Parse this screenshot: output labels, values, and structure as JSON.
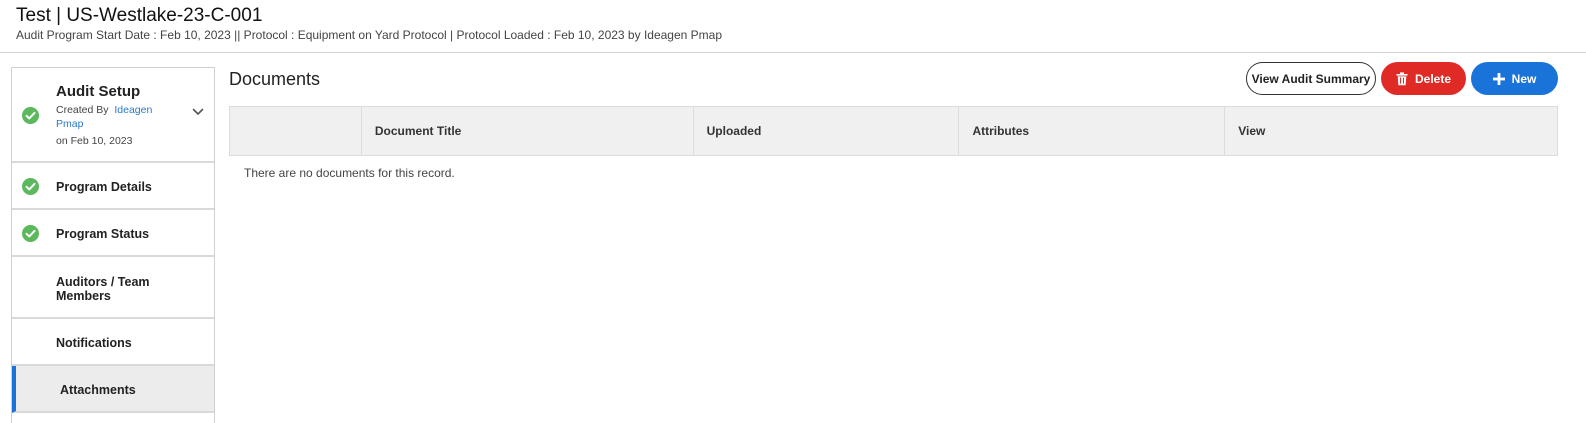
{
  "header": {
    "title": "Test | US-Westlake-23-C-001",
    "subtitle": "Audit Program Start Date : Feb 10, 2023 || Protocol : Equipment on Yard Protocol | Protocol Loaded : Feb 10, 2023 by Ideagen Pmap"
  },
  "sidebar": {
    "setup": {
      "title": "Audit Setup",
      "created_by_label": "Created By",
      "created_by_name": "Ideagen Pmap",
      "created_on": "on Feb 10, 2023",
      "status_icon": "check-circle-icon",
      "expand_icon": "chevron-down-icon"
    },
    "items": [
      {
        "label": "Program Details",
        "completed": true
      },
      {
        "label": "Program Status",
        "completed": true
      },
      {
        "label": "Auditors / Team Members",
        "completed": false
      },
      {
        "label": "Notifications",
        "completed": false
      },
      {
        "label": "Attachments",
        "completed": false,
        "active": true
      }
    ]
  },
  "main": {
    "title": "Documents",
    "buttons": {
      "view_summary": "View Audit Summary",
      "delete": "Delete",
      "new": "New"
    },
    "table": {
      "columns": [
        "",
        "Document Title",
        "Uploaded",
        "Attributes",
        "View"
      ],
      "empty_message": "There are no documents for this record."
    }
  },
  "colors": {
    "check_green": "#5cb85c",
    "delete_red": "#e02a26",
    "primary_blue": "#1a73d9",
    "link_blue": "#2a78c8"
  }
}
